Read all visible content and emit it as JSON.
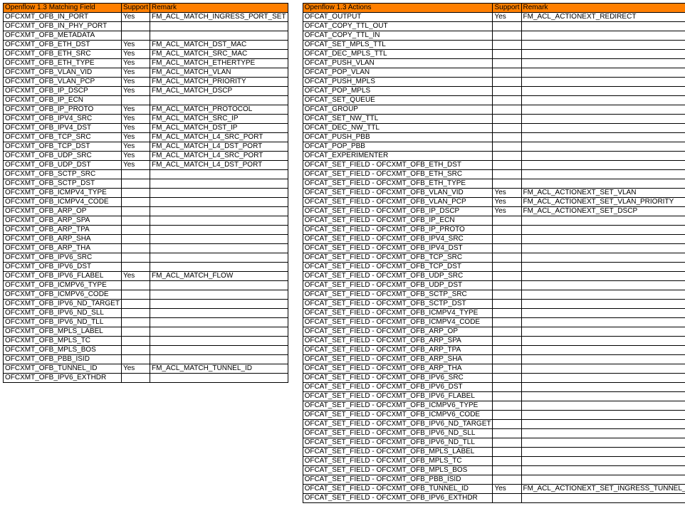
{
  "left": {
    "headers": [
      "Openflow 1.3 Matching Field",
      "Support",
      "Remark"
    ],
    "rows": [
      [
        "OFCXMT_OFB_IN_PORT",
        "Yes",
        "FM_ACL_MATCH_INGRESS_PORT_SET"
      ],
      [
        "OFCXMT_OFB_IN_PHY_PORT",
        "",
        ""
      ],
      [
        "OFCXMT_OFB_METADATA",
        "",
        ""
      ],
      [
        "OFCXMT_OFB_ETH_DST",
        "Yes",
        "FM_ACL_MATCH_DST_MAC"
      ],
      [
        "OFCXMT_OFB_ETH_SRC",
        "Yes",
        "FM_ACL_MATCH_SRC_MAC"
      ],
      [
        "OFCXMT_OFB_ETH_TYPE",
        "Yes",
        "FM_ACL_MATCH_ETHERTYPE"
      ],
      [
        "OFCXMT_OFB_VLAN_VID",
        "Yes",
        "FM_ACL_MATCH_VLAN"
      ],
      [
        "OFCXMT_OFB_VLAN_PCP",
        "Yes",
        "FM_ACL_MATCH_PRIORITY"
      ],
      [
        "OFCXMT_OFB_IP_DSCP",
        "Yes",
        "FM_ACL_MATCH_DSCP"
      ],
      [
        "OFCXMT_OFB_IP_ECN",
        "",
        ""
      ],
      [
        "OFCXMT_OFB_IP_PROTO",
        "Yes",
        "FM_ACL_MATCH_PROTOCOL"
      ],
      [
        "OFCXMT_OFB_IPV4_SRC",
        "Yes",
        "FM_ACL_MATCH_SRC_IP"
      ],
      [
        "OFCXMT_OFB_IPV4_DST",
        "Yes",
        "FM_ACL_MATCH_DST_IP"
      ],
      [
        "OFCXMT_OFB_TCP_SRC",
        "Yes",
        "FM_ACL_MATCH_L4_SRC_PORT"
      ],
      [
        "OFCXMT_OFB_TCP_DST",
        "Yes",
        "FM_ACL_MATCH_L4_DST_PORT"
      ],
      [
        "OFCXMT_OFB_UDP_SRC",
        "Yes",
        "FM_ACL_MATCH_L4_SRC_PORT"
      ],
      [
        "OFCXMT_OFB_UDP_DST",
        "Yes",
        "FM_ACL_MATCH_L4_DST_PORT"
      ],
      [
        "OFCXMT_OFB_SCTP_SRC",
        "",
        ""
      ],
      [
        "OFCXMT_OFB_SCTP_DST",
        "",
        ""
      ],
      [
        "OFCXMT_OFB_ICMPV4_TYPE",
        "",
        ""
      ],
      [
        "OFCXMT_OFB_ICMPV4_CODE",
        "",
        ""
      ],
      [
        "OFCXMT_OFB_ARP_OP",
        "",
        ""
      ],
      [
        "OFCXMT_OFB_ARP_SPA",
        "",
        ""
      ],
      [
        "OFCXMT_OFB_ARP_TPA",
        "",
        ""
      ],
      [
        "OFCXMT_OFB_ARP_SHA",
        "",
        ""
      ],
      [
        "OFCXMT_OFB_ARP_THA",
        "",
        ""
      ],
      [
        "OFCXMT_OFB_IPV6_SRC",
        "",
        ""
      ],
      [
        "OFCXMT_OFB_IPV6_DST",
        "",
        ""
      ],
      [
        "OFCXMT_OFB_IPV6_FLABEL",
        "Yes",
        "FM_ACL_MATCH_FLOW"
      ],
      [
        "OFCXMT_OFB_ICMPV6_TYPE",
        "",
        ""
      ],
      [
        "OFCXMT_OFB_ICMPV6_CODE",
        "",
        ""
      ],
      [
        "OFCXMT_OFB_IPV6_ND_TARGET",
        "",
        ""
      ],
      [
        "OFCXMT_OFB_IPV6_ND_SLL",
        "",
        ""
      ],
      [
        "OFCXMT_OFB_IPV6_ND_TLL",
        "",
        ""
      ],
      [
        "OFCXMT_OFB_MPLS_LABEL",
        "",
        ""
      ],
      [
        "OFCXMT_OFB_MPLS_TC",
        "",
        ""
      ],
      [
        "OFCXMT_OFB_MPLS_BOS",
        "",
        ""
      ],
      [
        "OFCXMT_OFB_PBB_ISID",
        "",
        ""
      ],
      [
        "OFCXMT_OFB_TUNNEL_ID",
        "Yes",
        "FM_ACL_MATCH_TUNNEL_ID"
      ],
      [
        "OFCXMT_OFB_IPV6_EXTHDR",
        "",
        ""
      ]
    ]
  },
  "right": {
    "headers": [
      "Openflow 1.3 Actions",
      "Support",
      "Remark"
    ],
    "rows": [
      [
        "OFCAT_OUTPUT",
        "Yes",
        "FM_ACL_ACTIONEXT_REDIRECT"
      ],
      [
        "OFCAT_COPY_TTL_OUT",
        "",
        ""
      ],
      [
        "OFCAT_COPY_TTL_IN",
        "",
        ""
      ],
      [
        "OFCAT_SET_MPLS_TTL",
        "",
        ""
      ],
      [
        "OFCAT_DEC_MPLS_TTL",
        "",
        ""
      ],
      [
        "OFCAT_PUSH_VLAN",
        "",
        ""
      ],
      [
        "OFCAT_POP_VLAN",
        "",
        ""
      ],
      [
        "OFCAT_PUSH_MPLS",
        "",
        ""
      ],
      [
        "OFCAT_POP_MPLS",
        "",
        ""
      ],
      [
        "OFCAT_SET_QUEUE",
        "",
        ""
      ],
      [
        "OFCAT_GROUP",
        "",
        ""
      ],
      [
        "OFCAT_SET_NW_TTL",
        "",
        ""
      ],
      [
        "OFCAT_DEC_NW_TTL",
        "",
        ""
      ],
      [
        "OFCAT_PUSH_PBB",
        "",
        ""
      ],
      [
        "OFCAT_POP_PBB",
        "",
        ""
      ],
      [
        "OFCAT_EXPERIMENTER",
        "",
        ""
      ],
      [
        "OFCAT_SET_FIELD - OFCXMT_OFB_ETH_DST",
        "",
        ""
      ],
      [
        "OFCAT_SET_FIELD - OFCXMT_OFB_ETH_SRC",
        "",
        ""
      ],
      [
        "OFCAT_SET_FIELD - OFCXMT_OFB_ETH_TYPE",
        "",
        ""
      ],
      [
        "OFCAT_SET_FIELD - OFCXMT_OFB_VLAN_VID",
        "Yes",
        "FM_ACL_ACTIONEXT_SET_VLAN"
      ],
      [
        "OFCAT_SET_FIELD - OFCXMT_OFB_VLAN_PCP",
        "Yes",
        "FM_ACL_ACTIONEXT_SET_VLAN_PRIORITY"
      ],
      [
        "OFCAT_SET_FIELD - OFCXMT_OFB_IP_DSCP",
        "Yes",
        "FM_ACL_ACTIONEXT_SET_DSCP"
      ],
      [
        "OFCAT_SET_FIELD - OFCXMT_OFB_IP_ECN",
        "",
        ""
      ],
      [
        "OFCAT_SET_FIELD - OFCXMT_OFB_IP_PROTO",
        "",
        ""
      ],
      [
        "OFCAT_SET_FIELD - OFCXMT_OFB_IPV4_SRC",
        "",
        ""
      ],
      [
        "OFCAT_SET_FIELD - OFCXMT_OFB_IPV4_DST",
        "",
        ""
      ],
      [
        "OFCAT_SET_FIELD - OFCXMT_OFB_TCP_SRC",
        "",
        ""
      ],
      [
        "OFCAT_SET_FIELD - OFCXMT_OFB_TCP_DST",
        "",
        ""
      ],
      [
        "OFCAT_SET_FIELD - OFCXMT_OFB_UDP_SRC",
        "",
        ""
      ],
      [
        "OFCAT_SET_FIELD - OFCXMT_OFB_UDP_DST",
        "",
        ""
      ],
      [
        "OFCAT_SET_FIELD - OFCXMT_OFB_SCTP_SRC",
        "",
        ""
      ],
      [
        "OFCAT_SET_FIELD - OFCXMT_OFB_SCTP_DST",
        "",
        ""
      ],
      [
        "OFCAT_SET_FIELD - OFCXMT_OFB_ICMPV4_TYPE",
        "",
        ""
      ],
      [
        "OFCAT_SET_FIELD - OFCXMT_OFB_ICMPV4_CODE",
        "",
        ""
      ],
      [
        "OFCAT_SET_FIELD - OFCXMT_OFB_ARP_OP",
        "",
        ""
      ],
      [
        "OFCAT_SET_FIELD - OFCXMT_OFB_ARP_SPA",
        "",
        ""
      ],
      [
        "OFCAT_SET_FIELD - OFCXMT_OFB_ARP_TPA",
        "",
        ""
      ],
      [
        "OFCAT_SET_FIELD - OFCXMT_OFB_ARP_SHA",
        "",
        ""
      ],
      [
        "OFCAT_SET_FIELD - OFCXMT_OFB_ARP_THA",
        "",
        ""
      ],
      [
        "OFCAT_SET_FIELD - OFCXMT_OFB_IPV6_SRC",
        "",
        ""
      ],
      [
        "OFCAT_SET_FIELD - OFCXMT_OFB_IPV6_DST",
        "",
        ""
      ],
      [
        "OFCAT_SET_FIELD - OFCXMT_OFB_IPV6_FLABEL",
        "",
        ""
      ],
      [
        "OFCAT_SET_FIELD - OFCXMT_OFB_ICMPV6_TYPE",
        "",
        ""
      ],
      [
        "OFCAT_SET_FIELD - OFCXMT_OFB_ICMPV6_CODE",
        "",
        ""
      ],
      [
        "OFCAT_SET_FIELD - OFCXMT_OFB_IPV6_ND_TARGET",
        "",
        ""
      ],
      [
        "OFCAT_SET_FIELD - OFCXMT_OFB_IPV6_ND_SLL",
        "",
        ""
      ],
      [
        "OFCAT_SET_FIELD - OFCXMT_OFB_IPV6_ND_TLL",
        "",
        ""
      ],
      [
        "OFCAT_SET_FIELD - OFCXMT_OFB_MPLS_LABEL",
        "",
        ""
      ],
      [
        "OFCAT_SET_FIELD - OFCXMT_OFB_MPLS_TC",
        "",
        ""
      ],
      [
        "OFCAT_SET_FIELD - OFCXMT_OFB_MPLS_BOS",
        "",
        ""
      ],
      [
        "OFCAT_SET_FIELD - OFCXMT_OFB_PBB_ISID",
        "",
        ""
      ],
      [
        "OFCAT_SET_FIELD - OFCXMT_OFB_TUNNEL_ID",
        "Yes",
        "FM_ACL_ACTIONEXT_SET_INGRESS_TUNNEL_ID"
      ],
      [
        "OFCAT_SET_FIELD - OFCXMT_OFB_IPV6_EXTHDR",
        "",
        ""
      ]
    ]
  }
}
